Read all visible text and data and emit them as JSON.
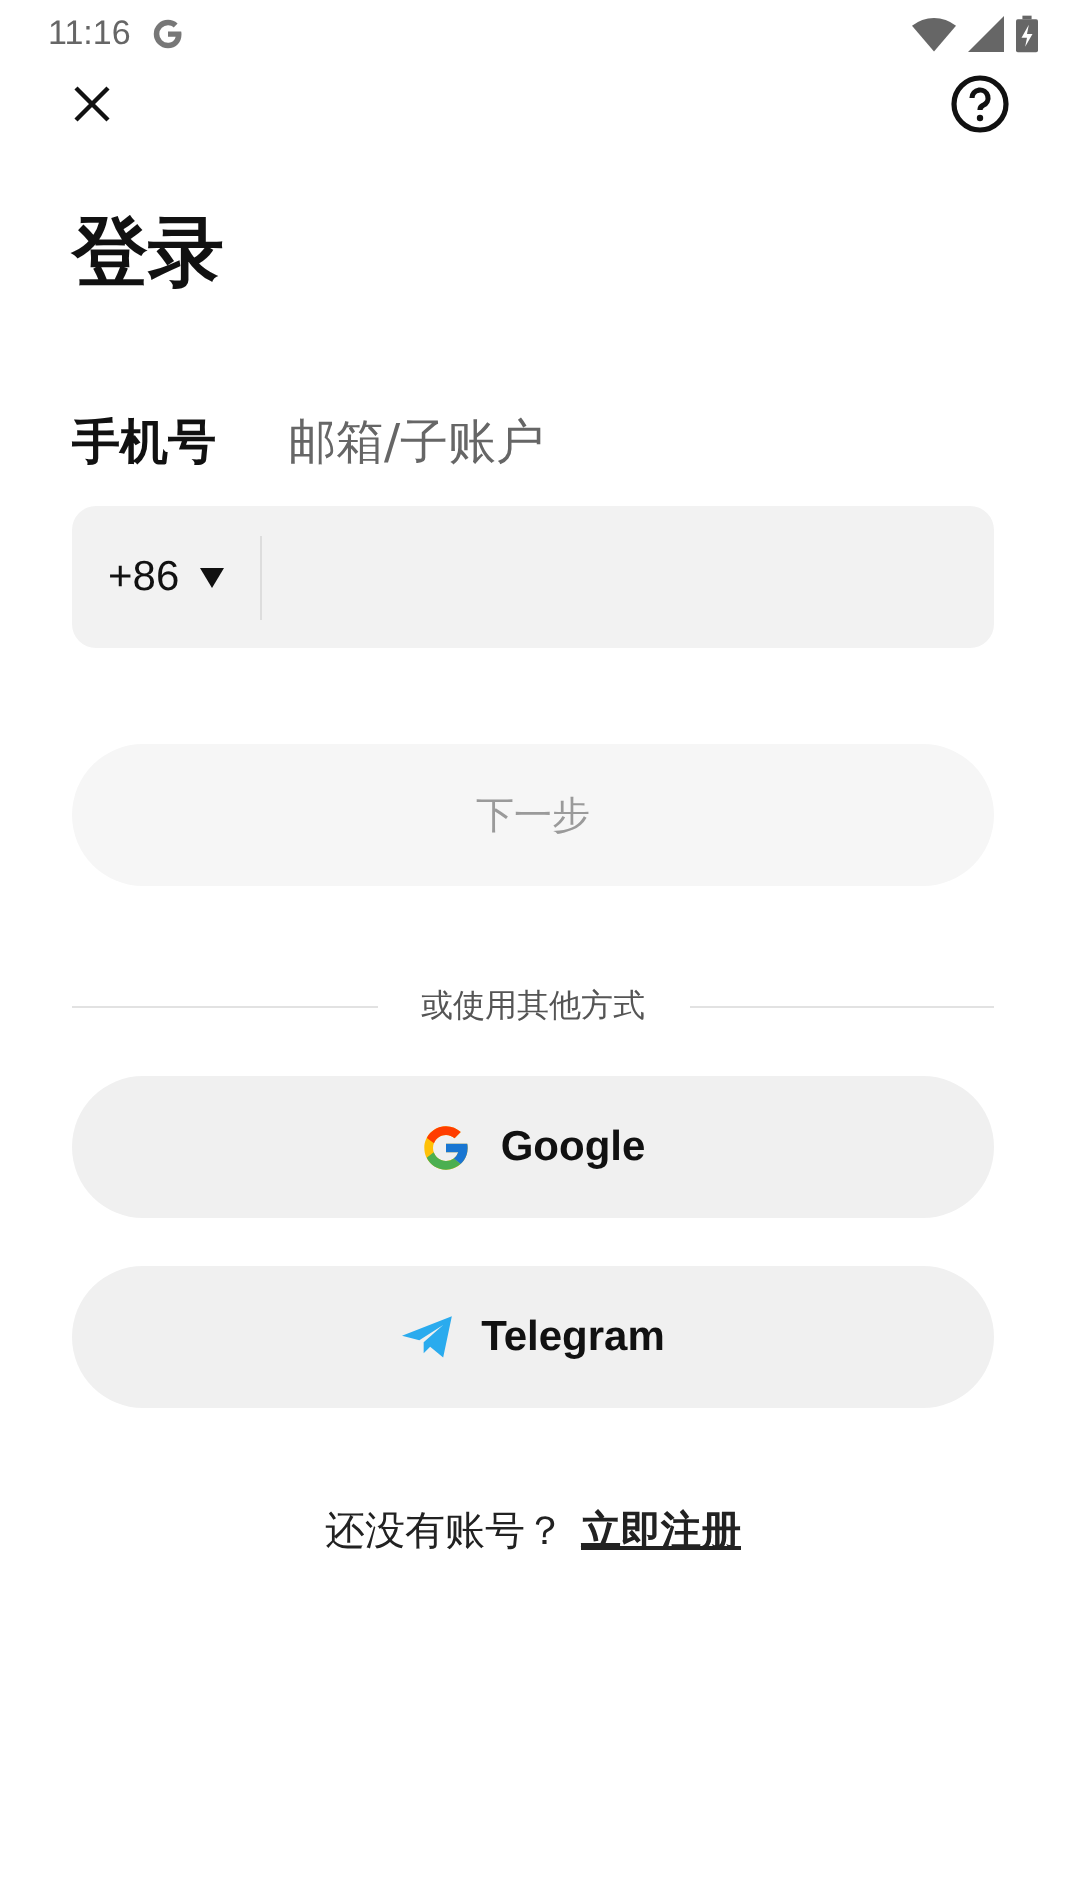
{
  "status_bar": {
    "time": "11:16"
  },
  "title": "登录",
  "tabs": [
    {
      "label": "手机号",
      "selected": true
    },
    {
      "label": "邮箱/子账户",
      "selected": false
    }
  ],
  "phone_field": {
    "country_code": "+86"
  },
  "next_button": {
    "label": "下一步",
    "disabled": true
  },
  "divider_text": "或使用其他方式",
  "social_buttons": [
    {
      "kind": "google",
      "label": "Google"
    },
    {
      "kind": "telegram",
      "label": "Telegram"
    }
  ],
  "footer": {
    "text": "还没有账号？",
    "link": "立即注册"
  }
}
